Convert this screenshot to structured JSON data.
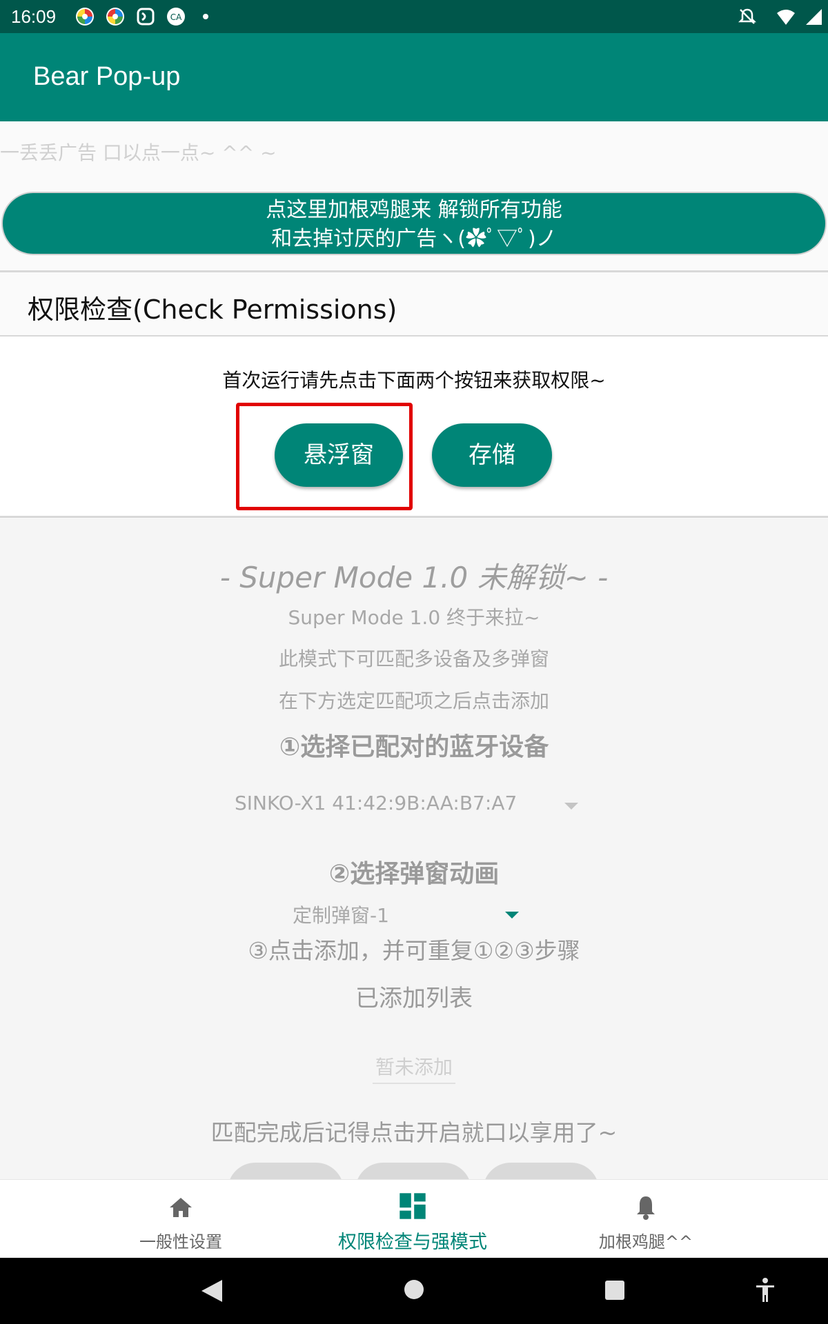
{
  "status_bar": {
    "time": "16:09"
  },
  "app_bar": {
    "title": "Bear Pop-up"
  },
  "ad_banner": {
    "text": "一丢丢广告 口以点一点~ ^^ ~"
  },
  "unlock_button": {
    "line1": "点这里加根鸡腿来 解锁所有功能",
    "line2": "和去掉讨厌的广告ヽ(✿ﾟ▽ﾟ)ノ"
  },
  "permissions": {
    "title": "权限检查(Check Permissions)",
    "hint": "首次运行请先点击下面两个按钮来获取权限~",
    "overlay_button": "悬浮窗",
    "storage_button": "存储"
  },
  "super_mode": {
    "title": "- Super Mode 1.0 未解锁~ -",
    "line1": "Super Mode 1.0 终于来拉~",
    "line2": "此模式下可匹配多设备及多弹窗",
    "line3": "在下方选定匹配项之后点击添加",
    "step1": "①选择已配对的蓝牙设备",
    "device_selected": "SINKO-X1  41:42:9B:AA:B7:A7",
    "step2": "②选择弹窗动画",
    "animation_selected": "定制弹窗-1",
    "step3": "③点击添加，并可重复①②③步骤",
    "added_list_title": "已添加列表",
    "added_empty": "暂未添加",
    "footer_hint": "匹配完成后记得点击开启就口以享用了~"
  },
  "bottom_nav": {
    "items": [
      {
        "label": "一般性设置",
        "icon": "home-icon"
      },
      {
        "label": "权限检查与强模式",
        "icon": "dashboard-icon"
      },
      {
        "label": "加根鸡腿^^",
        "icon": "bell-icon"
      }
    ],
    "active_index": 1
  },
  "colors": {
    "primary": "#008577",
    "primary_dark": "#00574b",
    "highlight_box": "#e10000"
  }
}
